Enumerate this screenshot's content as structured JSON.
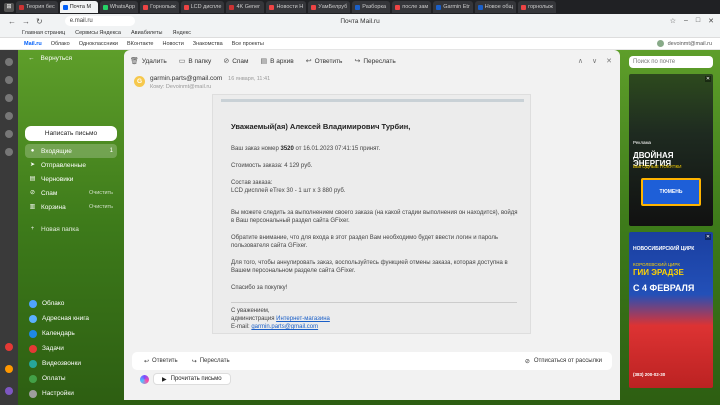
{
  "browser": {
    "tabs": [
      {
        "label": "Теория бес",
        "color": "#c33"
      },
      {
        "label": "Почта М",
        "color": "#005ff9",
        "active": true
      },
      {
        "label": "WhatsApp",
        "color": "#25d366"
      },
      {
        "label": "Горнолыж",
        "color": "#e44"
      },
      {
        "label": "LCD диспле",
        "color": "#e44"
      },
      {
        "label": "4K Gener",
        "color": "#c33"
      },
      {
        "label": "Новости H",
        "color": "#e44"
      },
      {
        "label": "УамБелруб",
        "color": "#e44"
      },
      {
        "label": "Разборка",
        "color": "#1a5fc8"
      },
      {
        "label": "после зам",
        "color": "#e44"
      },
      {
        "label": "Garmin Etr",
        "color": "#1a5fc8"
      },
      {
        "label": "Новое общ",
        "color": "#1a5fc8"
      },
      {
        "label": "горнолыж",
        "color": "#e44"
      }
    ],
    "url": "e.mail.ru",
    "page_title": "Почта Mail.ru",
    "bookmarks": [
      "Главная страниц",
      "Сервисы Яндекса",
      "Авиабилеты",
      "Яндекс"
    ]
  },
  "mail_nav": {
    "brand": "Mail.ru",
    "items": [
      "Облако",
      "Одноклассники",
      "ВКонтакте",
      "Новости",
      "Знакомства",
      "Все проекты"
    ],
    "user_email": "devoinmt@mail.ru"
  },
  "sidebar": {
    "back_label": "Вернуться",
    "compose_label": "Написать письмо",
    "folders": [
      {
        "label": "Входящие",
        "icon": "inbox-icon",
        "count": "1",
        "active": true
      },
      {
        "label": "Отправленные",
        "icon": "sent-icon"
      },
      {
        "label": "Черновики",
        "icon": "drafts-icon"
      },
      {
        "label": "Спам",
        "icon": "spam-icon",
        "sub": "Очистить"
      },
      {
        "label": "Корзина",
        "icon": "trash-icon",
        "sub": "Очистить"
      }
    ],
    "new_folder_label": "Новая папка",
    "services": [
      {
        "label": "Облако",
        "color": "#4fa3ff"
      },
      {
        "label": "Адресная книга",
        "color": "#5ab0ff"
      },
      {
        "label": "Календарь",
        "color": "#1e88e5"
      },
      {
        "label": "Задачи",
        "color": "#e53935"
      },
      {
        "label": "Видеозвонки",
        "color": "#26a69a"
      },
      {
        "label": "Оплаты",
        "color": "#43a047"
      },
      {
        "label": "Настройки",
        "color": "#9e9e9e"
      }
    ]
  },
  "toolbar": {
    "delete": "Удалить",
    "to_folder": "В папку",
    "spam": "Спам",
    "archive": "В архив",
    "reply": "Ответить",
    "forward": "Переслать"
  },
  "message": {
    "sender_initial": "G",
    "sender": "garmin.parts@gmail.com",
    "date": "16 января, 11:41",
    "to_line": "Кому: Devoinmt@mail.ru",
    "greeting": "Уважаемый(ая) Алексей Владимирович Турбин,",
    "order_prefix": "Ваш заказ номер",
    "order_number": "3520",
    "order_suffix": "от 16.01.2023 07:41:15 принят.",
    "cost": "Стоимость заказа: 4 129 руб.",
    "composition_label": "Состав заказа:",
    "composition_item": "LCD дисплей eTrex 30 - 1 шт x 3 880 руб.",
    "tracking": "Вы можете следить за выполнением своего заказа (на какой стадии выполнения он находится), войдя в Ваш персональный раздел сайта GFixer.",
    "login_note": "Обратите внимание, что для входа в этот раздел Вам необходимо будет ввести логин и пароль пользователя сайта GFixer.",
    "cancel_note": "Для того, чтобы аннулировать заказ, воспользуйтесь функцией отмены заказа, которая доступна в Вашем персональном разделе сайта GFixer.",
    "thanks": "Спасибо за покупку!",
    "regards": "С уважением,",
    "admin_prefix": "администрация",
    "admin_link": "Интернет-магазина",
    "email_prefix": "E-mail:",
    "email_link": "garmin.parts@gmail.com"
  },
  "reply_bar": {
    "reply": "Ответить",
    "forward": "Переслать",
    "unsubscribe": "Отписаться от рассылки",
    "read_aloud": "Прочитать письмо"
  },
  "right": {
    "search_placeholder": "Поиск по почте",
    "ad1": {
      "label": "Реклама",
      "headline": "ДВОЙНАЯ ЭНЕРГИЯ",
      "sub": "ВЫГОДНЫЕ ПОКУПКИ",
      "product": "ТЮМЕНЬ"
    },
    "ad2": {
      "small": "НОВОСИБИРСКИЙ ЦИРК",
      "top": "КОРОЛЕВСКИЙ ЦИРК",
      "name": "ГИИ ЭРАДЗЕ",
      "date": "С 4 ФЕВРАЛЯ",
      "phone": "(383) 200-02-30"
    }
  }
}
